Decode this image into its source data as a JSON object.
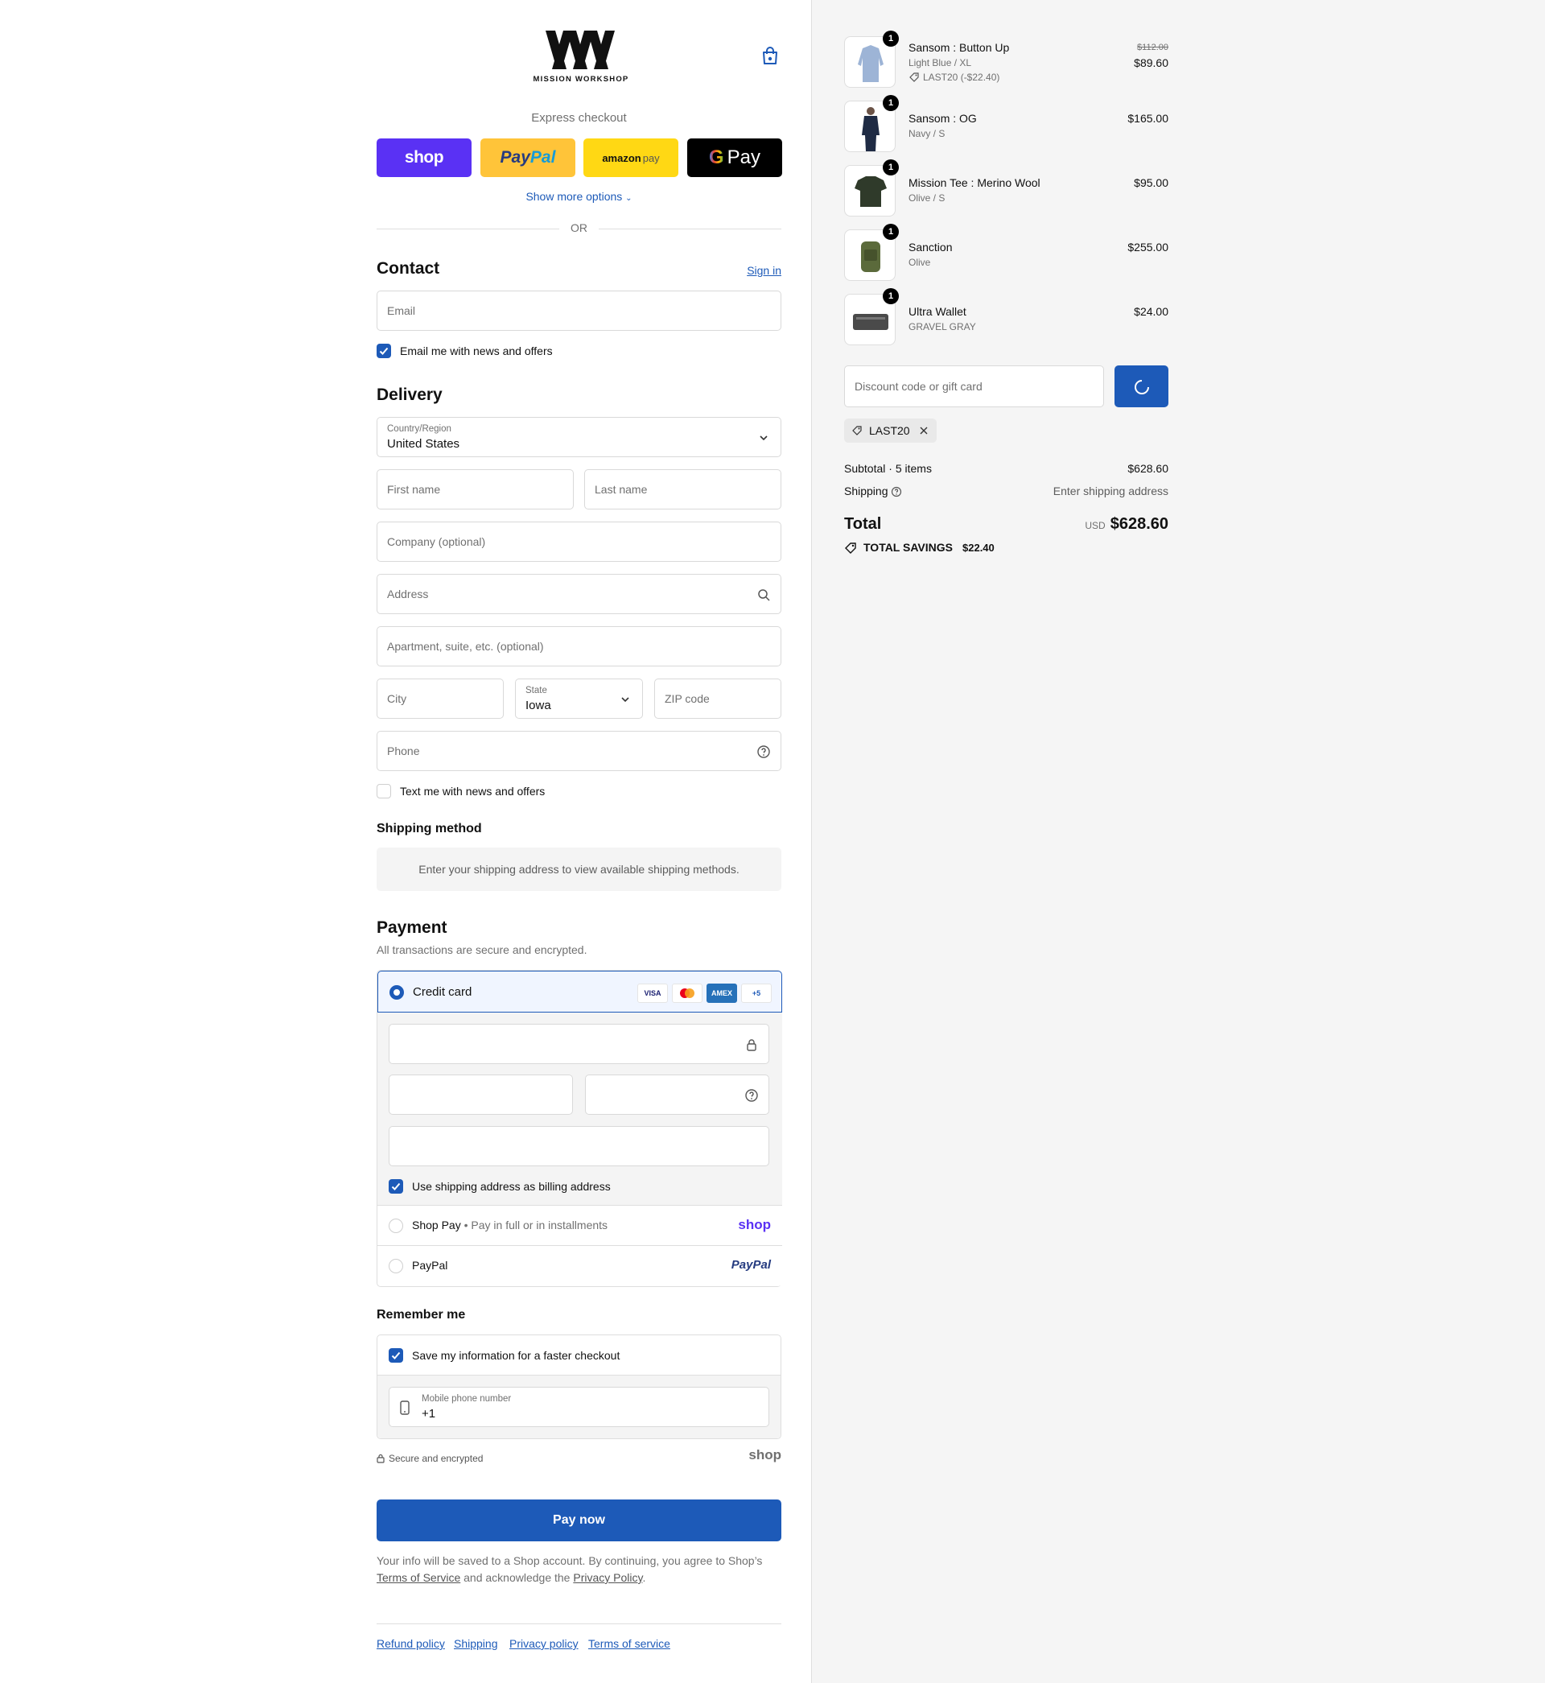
{
  "header": {
    "brand": "MISSION WORKSHOP"
  },
  "express": {
    "title": "Express checkout",
    "shop": "shop",
    "paypal_a": "Pay",
    "paypal_b": "Pal",
    "amazon_a": "amazon",
    "amazon_b": "pay",
    "gpay": "Pay",
    "more": "Show more options",
    "or": "OR"
  },
  "contact": {
    "title": "Contact",
    "sign_in": "Sign in",
    "email_placeholder": "Email",
    "news_label": "Email me with news and offers"
  },
  "delivery": {
    "title": "Delivery",
    "country_label": "Country/Region",
    "country_value": "United States",
    "first_name": "First name",
    "last_name": "Last name",
    "company": "Company (optional)",
    "address": "Address",
    "apartment": "Apartment, suite, etc. (optional)",
    "city": "City",
    "state_label": "State",
    "state_value": "Iowa",
    "zip": "ZIP code",
    "phone": "Phone",
    "text_label": "Text me with news and offers"
  },
  "shipping_method": {
    "title": "Shipping method",
    "note": "Enter your shipping address to view available shipping methods."
  },
  "payment": {
    "title": "Payment",
    "subtitle": "All transactions are secure and encrypted.",
    "credit_card": "Credit card",
    "cards": [
      "VISA",
      "",
      "AMEX",
      "+5"
    ],
    "billing_label": "Use shipping address as billing address",
    "shop_pay": "Shop Pay",
    "shop_pay_desc": "Pay in full or in installments",
    "shop_logo": "shop",
    "paypal": "PayPal",
    "paypal_logo": "PayPal"
  },
  "remember": {
    "title": "Remember me",
    "save_label": "Save my information for a faster checkout",
    "mobile_label": "Mobile phone number",
    "mobile_value": "+1",
    "secure": "Secure and encrypted",
    "shop_logo": "shop"
  },
  "pay_now": "Pay now",
  "legal": {
    "part1": "Your info will be saved to a Shop account. By continuing, you agree to Shop’s",
    "tos": "Terms of Service",
    "part2": " and acknowledge the ",
    "privacy": "Privacy Policy",
    "part3": "."
  },
  "footer": {
    "links": [
      "Refund policy",
      "Shipping",
      "Privacy policy",
      "Terms of service"
    ]
  },
  "cart": {
    "items": [
      {
        "qty": "1",
        "name": "Sansom : Button Up",
        "variant": "Light Blue / XL",
        "discount": "LAST20 (-$22.40)",
        "old_price": "$112.00",
        "price": "$89.60",
        "color": "#9db4d6"
      },
      {
        "qty": "1",
        "name": "Sansom : OG",
        "variant": "Navy / S",
        "price": "$165.00",
        "color": "#1f2b44"
      },
      {
        "qty": "1",
        "name": "Mission Tee : Merino Wool",
        "variant": "Olive / S",
        "price": "$95.00",
        "color": "#2f3a2a"
      },
      {
        "qty": "1",
        "name": "Sanction",
        "variant": "Olive",
        "price": "$255.00",
        "color": "#5b6a3b"
      },
      {
        "qty": "1",
        "name": "Ultra Wallet",
        "variant": "GRAVEL GRAY",
        "price": "$24.00",
        "color": "#4a4a4a"
      }
    ],
    "discount_placeholder": "Discount code or gift card",
    "applied_code": "LAST20",
    "subtotal_label": "Subtotal · 5 items",
    "subtotal_value": "$628.60",
    "shipping_label": "Shipping",
    "shipping_value": "Enter shipping address",
    "total_label": "Total",
    "currency": "USD",
    "total_value": "$628.60",
    "savings_label": "TOTAL SAVINGS",
    "savings_value": "$22.40"
  },
  "colors": {
    "accent": "#1d5ab8",
    "shop_purple": "#5a31f4",
    "paypal_yellow": "#ffc439",
    "amazon_yellow": "#ffd814"
  }
}
